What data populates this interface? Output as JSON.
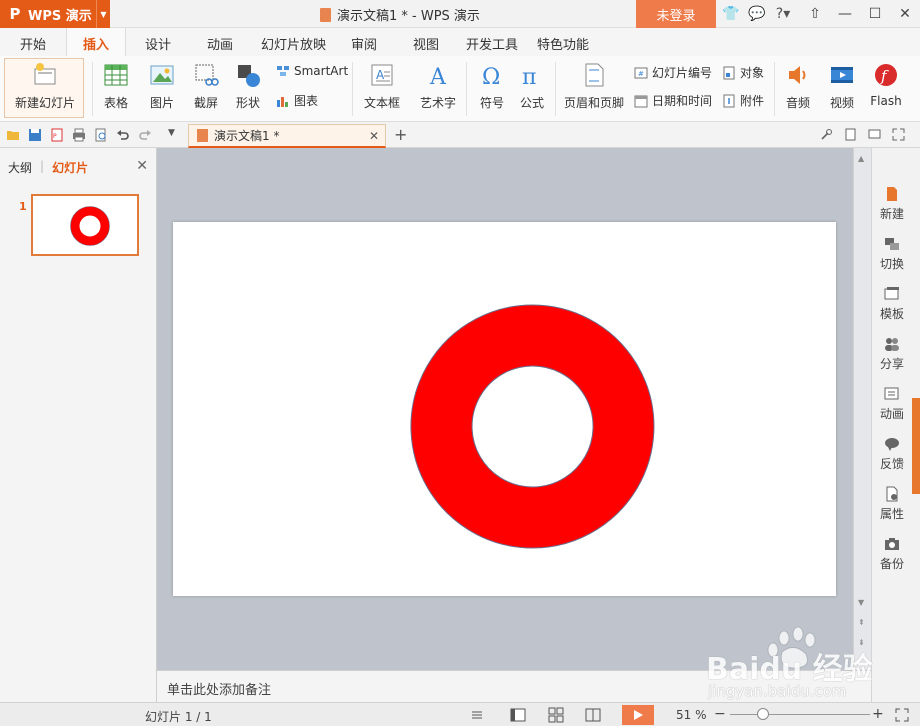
{
  "app": {
    "name": "WPS 演示",
    "title": "演示文稿1 * - WPS 演示",
    "login": "未登录"
  },
  "menu": {
    "tabs": [
      "开始",
      "插入",
      "设计",
      "动画",
      "幻灯片放映",
      "审阅",
      "视图",
      "开发工具",
      "特色功能"
    ],
    "active": "插入"
  },
  "ribbon": {
    "new_slide": "新建幻灯片",
    "table": "表格",
    "picture": "图片",
    "screenshot": "截屏",
    "shape": "形状",
    "smartart": "SmartArt",
    "chart": "图表",
    "textbox": "文本框",
    "wordart": "艺术字",
    "symbol": "符号",
    "formula": "公式",
    "header_footer": "页眉和页脚",
    "slide_number": "幻灯片编号",
    "object": "对象",
    "datetime": "日期和时间",
    "attachment": "附件",
    "audio": "音频",
    "video": "视频",
    "flash": "Flash"
  },
  "doc_tab": {
    "label": "演示文稿1 *"
  },
  "left_panel": {
    "tab_outline": "大纲",
    "tab_slides": "幻灯片",
    "thumb_number": "1"
  },
  "notes": {
    "placeholder": "单击此处添加备注"
  },
  "right_sidebar": [
    "新建",
    "切换",
    "模板",
    "分享",
    "动画",
    "反馈",
    "属性",
    "备份"
  ],
  "status": {
    "slide": "幻灯片 1 / 1",
    "zoom": "51 %",
    "zoom_level": 0.51
  },
  "slide": {
    "shape": "donut",
    "fill": "#ff0000",
    "stroke": "#6b6b8a"
  },
  "colors": {
    "accent": "#e45b18",
    "login_bg": "#ef7a4a"
  },
  "watermark": {
    "brand": "Baidu 经验",
    "url": "jingyan.baidu.com"
  }
}
